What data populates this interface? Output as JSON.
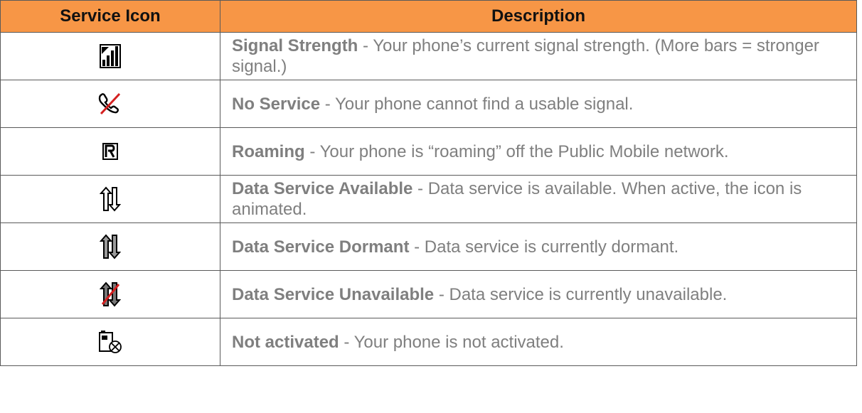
{
  "header": {
    "icon_col": "Service Icon",
    "desc_col": "Description"
  },
  "rows": [
    {
      "icon": "signal-strength-icon",
      "title": "Signal Strength",
      "text": " - Your phone’s current signal strength. (More bars = stronger signal.)"
    },
    {
      "icon": "no-service-icon",
      "title": "No Service",
      "text": " - Your phone cannot find a usable signal."
    },
    {
      "icon": "roaming-icon",
      "title": "Roaming",
      "text": " - Your phone is “roaming” off the Public Mobile network."
    },
    {
      "icon": "data-service-available-icon",
      "title": "Data Service Available",
      "text": " - Data service is available. When active, the icon is animated."
    },
    {
      "icon": "data-service-dormant-icon",
      "title": "Data Service Dormant",
      "text": " - Data service is currently dormant."
    },
    {
      "icon": "data-service-unavailable-icon",
      "title": "Data Service Unavailable",
      "text": " - Data service is currently unavailable."
    },
    {
      "icon": "not-activated-icon",
      "title": "Not activated",
      "text": " - Your phone is not activated."
    }
  ],
  "colors": {
    "header_bg": "#f79646",
    "desc_text": "#7f7f7f",
    "border": "#5a5a5a"
  }
}
